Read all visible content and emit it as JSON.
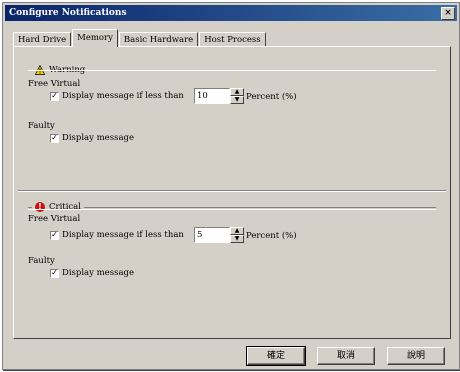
{
  "window": {
    "title": "Configure Notifications",
    "close_glyph": "×"
  },
  "tabs": [
    {
      "label": "Hard Drive",
      "active": false
    },
    {
      "label": "Memory",
      "active": true
    },
    {
      "label": "Basic Hardware",
      "active": false
    },
    {
      "label": "Host Process",
      "active": false
    }
  ],
  "warning": {
    "title": "Warning",
    "icon": "warning-triangle-icon",
    "free_virtual_label": "Free Virtual",
    "free_virtual_check_label": "Display message if less than",
    "free_virtual_checked": true,
    "free_virtual_value": "10",
    "percent_label": "Percent (%)",
    "faulty_label": "Faulty",
    "faulty_check_label": "Display message",
    "faulty_checked": true
  },
  "critical": {
    "title": "Critical",
    "icon": "critical-stop-icon",
    "icon_glyph": "!",
    "free_virtual_label": "Free Virtual",
    "free_virtual_check_label": "Display message if less than",
    "free_virtual_checked": true,
    "free_virtual_value": "5",
    "percent_label": "Percent (%)",
    "faulty_label": "Faulty",
    "faulty_check_label": "Display message",
    "faulty_checked": true
  },
  "buttons": {
    "ok": "確定",
    "cancel": "取消",
    "help": "說明"
  },
  "colors": {
    "titlebar": "#0a246a",
    "face": "#d4d0c8",
    "critical": "#cc1010",
    "warning": "#f5d000"
  }
}
